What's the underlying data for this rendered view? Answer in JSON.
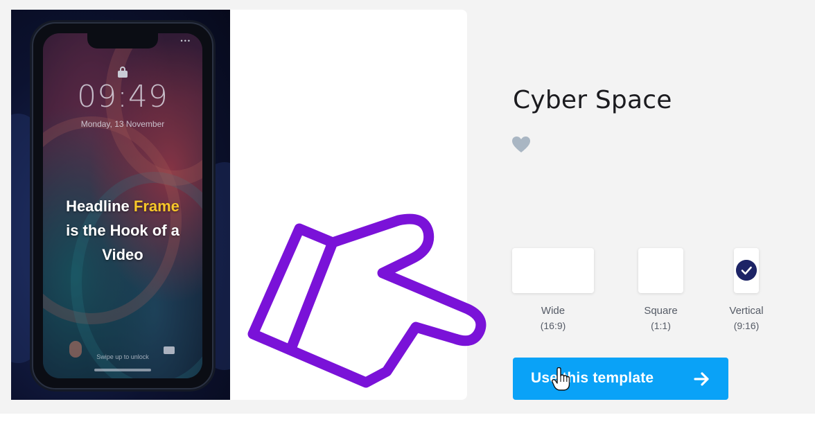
{
  "template": {
    "title": "Cyber Space"
  },
  "preview": {
    "time": "09:49",
    "date": "Monday, 13 November",
    "headline_part1": "Headline ",
    "headline_accent": "Frame",
    "headline_line2": "is the Hook of a",
    "headline_line3": "Video",
    "swipe_text": "Swipe up to unlock",
    "accent_color": "#f7c629"
  },
  "formats": [
    {
      "label": "Wide",
      "ratio": "(16:9)",
      "selected": false
    },
    {
      "label": "Square",
      "ratio": "(1:1)",
      "selected": false
    },
    {
      "label": "Vertical",
      "ratio": "(9:16)",
      "selected": true
    }
  ],
  "actions": {
    "use_template_label": "Use this template",
    "button_color": "#0aa2f7"
  },
  "icons": {
    "heart": "heart-icon",
    "check": "check-icon",
    "arrow": "arrow-right-icon",
    "cursor": "hand-pointer-cursor-icon",
    "overlay": "pointing-hand-icon"
  }
}
